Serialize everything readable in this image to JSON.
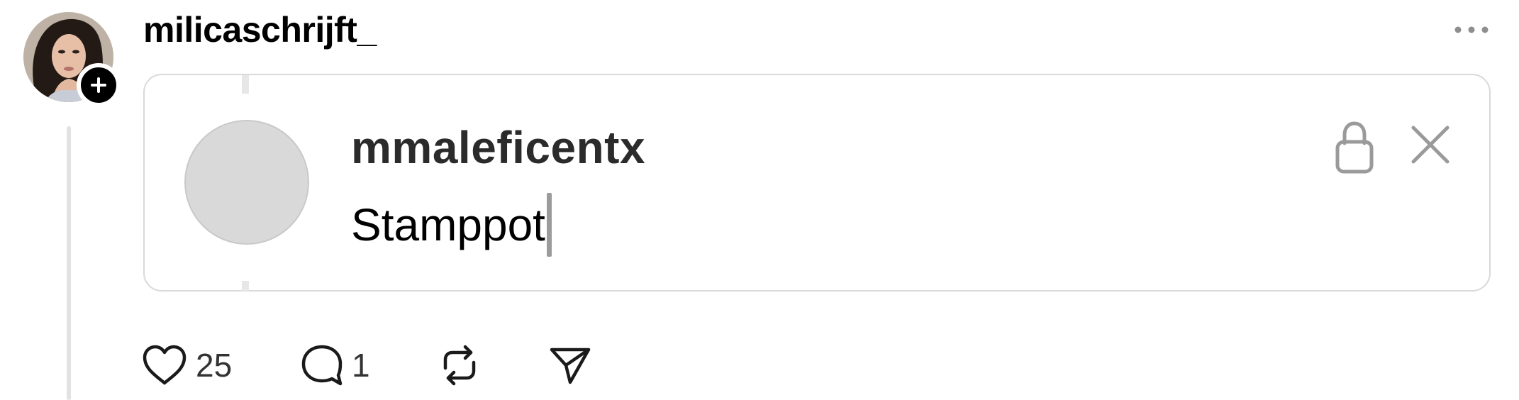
{
  "post": {
    "username": "milicaschrijft_",
    "avatar_alt": "profile-photo",
    "follow_badge_icon": "plus-icon",
    "more_icon": "more-horizontal-icon"
  },
  "quote": {
    "username": "mmaleficentx",
    "text": "Stamppot",
    "lock_icon": "lock-icon",
    "close_icon": "close-icon"
  },
  "actions": {
    "like_count": "25",
    "comment_count": "1",
    "like_icon": "heart-icon",
    "comment_icon": "comment-icon",
    "repost_icon": "repost-icon",
    "share_icon": "send-icon"
  },
  "colors": {
    "card_border": "#d9d9d9",
    "placeholder_avatar": "#d9d9d9",
    "thread_line": "#e2e2e2",
    "icon": "#1a1a1a"
  }
}
